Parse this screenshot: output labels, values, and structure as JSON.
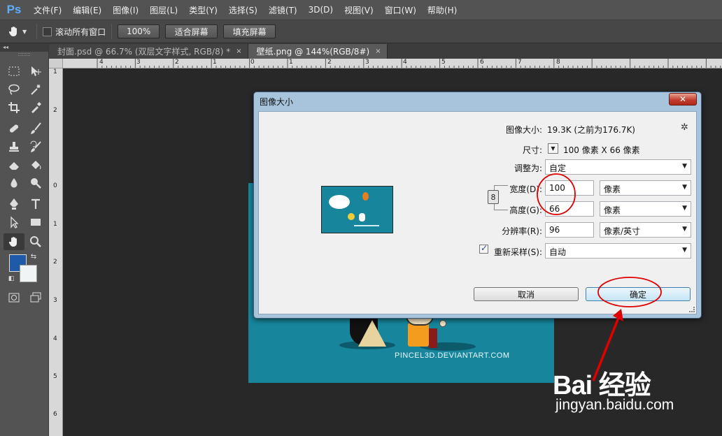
{
  "app": {
    "logo": "Ps"
  },
  "menu": [
    "文件(F)",
    "编辑(E)",
    "图像(I)",
    "图层(L)",
    "类型(Y)",
    "选择(S)",
    "滤镜(T)",
    "3D(D)",
    "视图(V)",
    "窗口(W)",
    "帮助(H)"
  ],
  "options": {
    "scroll_all_label": "滚动所有窗口",
    "zoom_100": "100%",
    "fit_screen": "适合屏幕",
    "fill_screen": "填充屏幕"
  },
  "tabs": [
    {
      "label": "封面.psd @ 66.7% (双层文字样式, RGB/8) *",
      "close": "×",
      "active": false
    },
    {
      "label": "壁纸.png @ 144%(RGB/8#)",
      "close": "×",
      "active": true
    }
  ],
  "rulers": {
    "top": [
      "4",
      "3",
      "2",
      "1",
      "0",
      "1",
      "2",
      "3",
      "4",
      "5",
      "6",
      "7",
      "8"
    ],
    "left": [
      "1",
      "2",
      "0",
      "1",
      "2",
      "3",
      "4",
      "5",
      "6"
    ]
  },
  "document": {
    "caption": "PINCEL3D.DEVIANTART.COM"
  },
  "dialog": {
    "title": "图像大小",
    "close": "✕",
    "image_size_label": "图像大小:",
    "image_size_value": "19.3K (之前为176.7K)",
    "dimensions_label": "尺寸:",
    "dimensions_value": "100 像素  X  66 像素",
    "fit_to_label": "调整为:",
    "fit_to_value": "自定",
    "width_label": "宽度(D):",
    "width_value": "100",
    "width_unit": "像素",
    "height_label": "高度(G):",
    "height_value": "66",
    "height_unit": "像素",
    "resolution_label": "分辨率(R):",
    "resolution_value": "96",
    "resolution_unit": "像素/英寸",
    "resample_label": "重新采样(S):",
    "resample_checked": true,
    "resample_value": "自动",
    "cancel": "取消",
    "ok": "确定"
  },
  "watermark": {
    "logo": "Bai 经验",
    "url": "jingyan.baidu.com"
  },
  "colors": {
    "foreground": "#1f5aa8",
    "background": "#f0f4f4",
    "annotation": "#e00000"
  }
}
